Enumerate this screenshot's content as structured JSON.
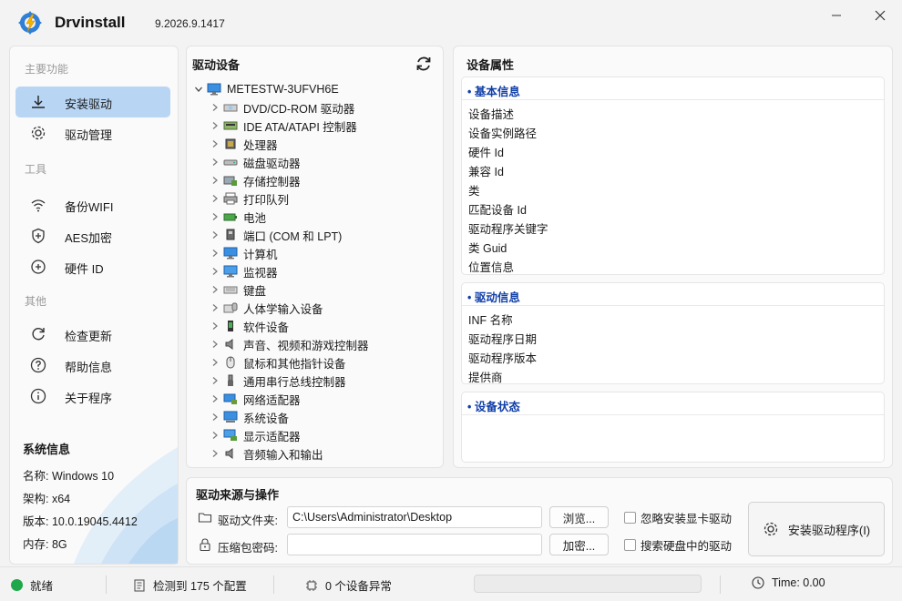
{
  "app": {
    "name": "Drvinstall",
    "version": "9.2026.9.1417"
  },
  "sidebar": {
    "sections": [
      "主要功能",
      "工具",
      "其他"
    ],
    "items": [
      {
        "label": "安装驱动",
        "icon": "download-icon",
        "active": true
      },
      {
        "label": "驱动管理",
        "icon": "gear-icon",
        "active": false
      },
      {
        "label": "备份WIFI",
        "icon": "wifi-icon",
        "active": false
      },
      {
        "label": "AES加密",
        "icon": "shield-icon",
        "active": false
      },
      {
        "label": "硬件 ID",
        "icon": "hardware-id-icon",
        "active": false
      },
      {
        "label": "检查更新",
        "icon": "refresh-icon",
        "active": false
      },
      {
        "label": "帮助信息",
        "icon": "help-icon",
        "active": false
      },
      {
        "label": "关于程序",
        "icon": "info-icon",
        "active": false
      }
    ],
    "system_info": {
      "title": "系统信息",
      "lines": [
        "名称: Windows 10",
        "架构: x64",
        "版本: 10.0.19045.4412",
        "内存: 8G"
      ]
    }
  },
  "devices": {
    "title": "驱动设备",
    "root": "METESTW-3UFVH6E",
    "items": [
      {
        "label": "DVD/CD-ROM 驱动器",
        "icon": "dvd-drive-icon"
      },
      {
        "label": "IDE ATA/ATAPI 控制器",
        "icon": "ide-controller-icon"
      },
      {
        "label": "处理器",
        "icon": "processor-icon"
      },
      {
        "label": "磁盘驱动器",
        "icon": "disk-drive-icon"
      },
      {
        "label": "存储控制器",
        "icon": "storage-controller-icon"
      },
      {
        "label": "打印队列",
        "icon": "printer-icon"
      },
      {
        "label": "电池",
        "icon": "battery-icon"
      },
      {
        "label": "端口 (COM 和 LPT)",
        "icon": "port-icon"
      },
      {
        "label": "计算机",
        "icon": "computer-icon"
      },
      {
        "label": "监视器",
        "icon": "monitor-icon"
      },
      {
        "label": "键盘",
        "icon": "keyboard-icon"
      },
      {
        "label": "人体学输入设备",
        "icon": "hid-icon"
      },
      {
        "label": "软件设备",
        "icon": "software-device-icon"
      },
      {
        "label": "声音、视频和游戏控制器",
        "icon": "sound-icon"
      },
      {
        "label": "鼠标和其他指针设备",
        "icon": "mouse-icon"
      },
      {
        "label": "通用串行总线控制器",
        "icon": "usb-icon"
      },
      {
        "label": "网络适配器",
        "icon": "network-adapter-icon"
      },
      {
        "label": "系统设备",
        "icon": "system-device-icon"
      },
      {
        "label": "显示适配器",
        "icon": "display-adapter-icon"
      },
      {
        "label": "音频输入和输出",
        "icon": "audio-io-icon"
      }
    ]
  },
  "properties": {
    "title": "设备属性",
    "basic": {
      "heading": "基本信息",
      "fields": [
        "设备描述",
        "设备实例路径",
        "硬件 Id",
        "兼容 Id",
        "类",
        "匹配设备 Id",
        "驱动程序关键字",
        "类 Guid",
        "位置信息"
      ]
    },
    "driver": {
      "heading": "驱动信息",
      "fields": [
        "INF 名称",
        "驱动程序日期",
        "驱动程序版本",
        "提供商"
      ]
    },
    "status": {
      "heading": "设备状态"
    }
  },
  "source": {
    "title": "驱动来源与操作",
    "folder_label": "驱动文件夹:",
    "folder_value": "C:\\Users\\Administrator\\Desktop",
    "password_label": "压缩包密码:",
    "password_value": "",
    "browse_label": "浏览...",
    "encrypt_label": "加密...",
    "option_skip_gpu": "忽略安装显卡驱动",
    "option_search_disk": "搜索硬盘中的驱动",
    "install_label": "安装驱动程序(I)"
  },
  "status": {
    "state": "就绪",
    "state_color": "#1ea84a",
    "detected": "检测到 175 个配置",
    "abnormal": "0 个设备异常",
    "progress": 0,
    "time": "Time: 0.00"
  }
}
